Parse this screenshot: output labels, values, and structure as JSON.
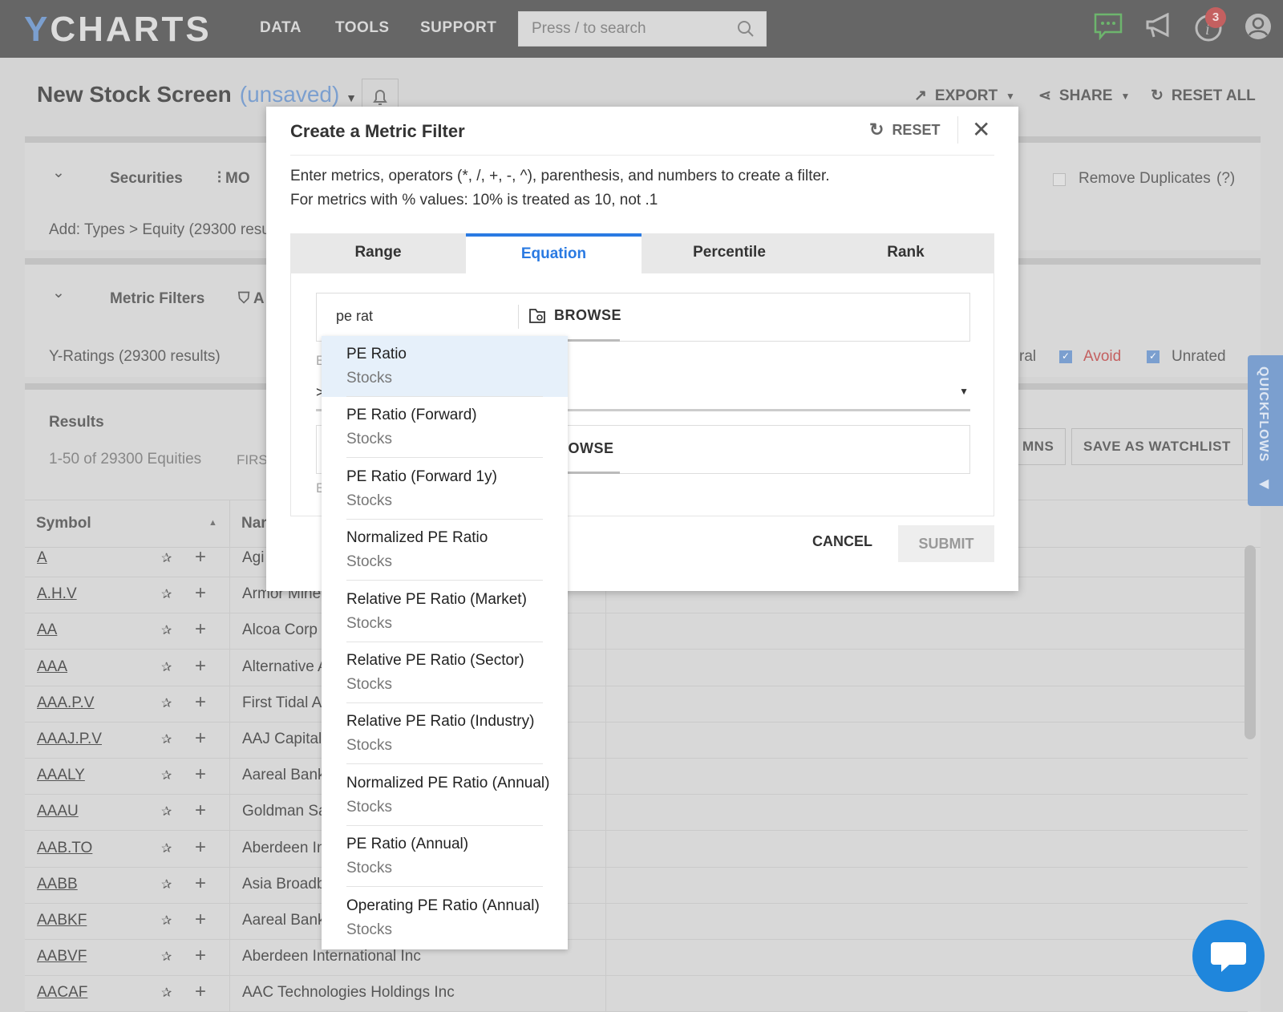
{
  "app": {
    "logo_y": "Y",
    "logo_rest": "CHARTS",
    "nav": [
      "DATA",
      "TOOLS",
      "SUPPORT"
    ],
    "search_placeholder": "Press / to search",
    "notification_count": "3"
  },
  "page": {
    "title": "New Stock Screen",
    "status": "(unsaved)",
    "actions": {
      "export": "EXPORT",
      "share": "SHARE",
      "reset_all": "RESET ALL"
    }
  },
  "securities": {
    "label": "Securities",
    "tab2": "MO",
    "summary": "Add: Types > Equity (29300 resul",
    "remove_duplicates": "Remove Duplicates",
    "help": "(?)"
  },
  "metric_filters": {
    "label": "Metric Filters",
    "tab2": "A",
    "yratings": "Y-Ratings (29300 results)",
    "partial": "ral",
    "avoid": "Avoid",
    "unrated": "Unrated"
  },
  "results": {
    "label": "Results",
    "count": "1-50 of 29300 Equities",
    "first": "FIRS",
    "columns_btn": "MNS",
    "watchlist_btn": "SAVE AS WATCHLIST",
    "headers": {
      "symbol": "Symbol",
      "name": "Nar"
    },
    "rows": [
      {
        "symbol": "A",
        "name": "Agi"
      },
      {
        "symbol": "A.H.V",
        "name": "Armor Mine"
      },
      {
        "symbol": "AA",
        "name": "Alcoa Corp"
      },
      {
        "symbol": "AAA",
        "name": "Alternative A"
      },
      {
        "symbol": "AAA.P.V",
        "name": "First Tidal A"
      },
      {
        "symbol": "AAAJ.P.V",
        "name": "AAJ Capital"
      },
      {
        "symbol": "AAALY",
        "name": "Aareal Bank"
      },
      {
        "symbol": "AAAU",
        "name": "Goldman Sa"
      },
      {
        "symbol": "AAB.TO",
        "name": "Aberdeen In"
      },
      {
        "symbol": "AABB",
        "name": "Asia Broadb"
      },
      {
        "symbol": "AABKF",
        "name": "Aareal Bank"
      },
      {
        "symbol": "AABVF",
        "name": "Aberdeen International Inc"
      },
      {
        "symbol": "AACAF",
        "name": "AAC Technologies Holdings Inc"
      }
    ]
  },
  "quickflows": "QUICKFLOWS",
  "modal": {
    "title": "Create a Metric Filter",
    "reset": "RESET",
    "desc1": "Enter metrics, operators (*, /, +, -, ^), parenthesis, and numbers to create a filter.",
    "desc2": "For metrics with % values: 10% is treated as 10, not .1",
    "tabs": [
      "Range",
      "Equation",
      "Percentile",
      "Rank"
    ],
    "active_tab": "Equation",
    "input_value": "pe rat",
    "browse": "BROWSE",
    "browse2": "ROWSE",
    "operator": ">",
    "helper": "E",
    "cancel": "CANCEL",
    "submit": "SUBMIT",
    "suggestions": [
      {
        "title": "PE Ratio",
        "sub": "Stocks"
      },
      {
        "title": "PE Ratio (Forward)",
        "sub": "Stocks"
      },
      {
        "title": "PE Ratio (Forward 1y)",
        "sub": "Stocks"
      },
      {
        "title": "Normalized PE Ratio",
        "sub": "Stocks"
      },
      {
        "title": "Relative PE Ratio (Market)",
        "sub": "Stocks"
      },
      {
        "title": "Relative PE Ratio (Sector)",
        "sub": "Stocks"
      },
      {
        "title": "Relative PE Ratio (Industry)",
        "sub": "Stocks"
      },
      {
        "title": "Normalized PE Ratio (Annual)",
        "sub": "Stocks"
      },
      {
        "title": "PE Ratio (Annual)",
        "sub": "Stocks"
      },
      {
        "title": "Operating PE Ratio (Annual)",
        "sub": "Stocks"
      }
    ]
  },
  "colors": {
    "accent": "#2a7ae2",
    "brand": "#7b9fcf",
    "avoid": "#c46060",
    "chat": "#1f86dc",
    "highlight": "#e6f0fa"
  }
}
